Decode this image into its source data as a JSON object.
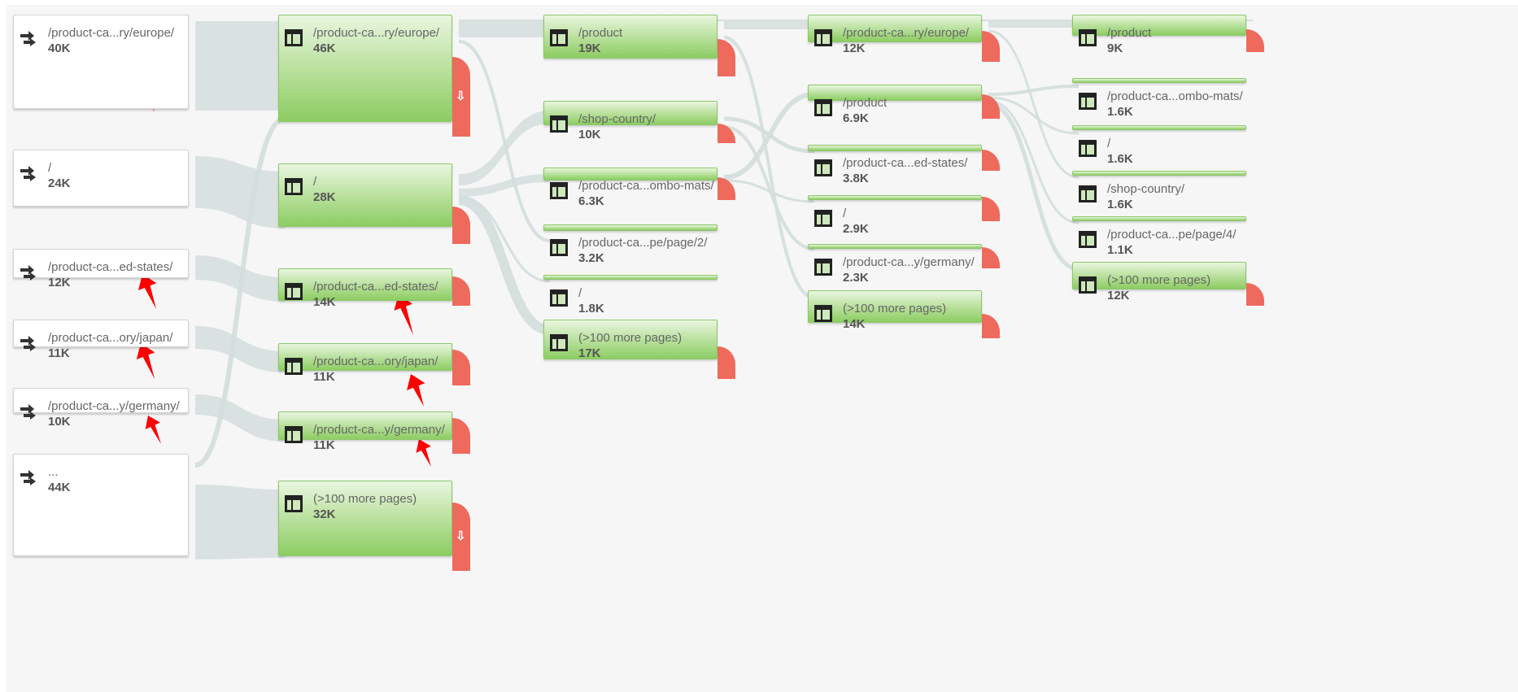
{
  "step0": [
    {
      "label": "/product-ca...ry/europe/",
      "value": "40K"
    },
    {
      "label": "/",
      "value": "24K"
    },
    {
      "label": "/product-ca...ed-states/",
      "value": "12K"
    },
    {
      "label": "/product-ca...ory/japan/",
      "value": "11K"
    },
    {
      "label": "/product-ca...y/germany/",
      "value": "10K"
    },
    {
      "label": "...",
      "value": "44K"
    }
  ],
  "step1": [
    {
      "label": "/product-ca...ry/europe/",
      "value": "46K"
    },
    {
      "label": "/",
      "value": "28K"
    },
    {
      "label": "/product-ca...ed-states/",
      "value": "14K"
    },
    {
      "label": "/product-ca...ory/japan/",
      "value": "11K"
    },
    {
      "label": "/product-ca...y/germany/",
      "value": "11K"
    },
    {
      "label": "(>100 more pages)",
      "value": "32K"
    }
  ],
  "step2": [
    {
      "label": "/product",
      "value": "19K"
    },
    {
      "label": "/shop-country/",
      "value": "10K"
    },
    {
      "label": "/product-ca...ombo-mats/",
      "value": "6.3K"
    },
    {
      "label": "/product-ca...pe/page/2/",
      "value": "3.2K"
    },
    {
      "label": "/",
      "value": "1.8K"
    },
    {
      "label": "(>100 more pages)",
      "value": "17K"
    }
  ],
  "step3": [
    {
      "label": "/product-ca...ry/europe/",
      "value": "12K"
    },
    {
      "label": "/product",
      "value": "6.9K"
    },
    {
      "label": "/product-ca...ed-states/",
      "value": "3.8K"
    },
    {
      "label": "/",
      "value": "2.9K"
    },
    {
      "label": "/product-ca...y/germany/",
      "value": "2.3K"
    },
    {
      "label": "(>100 more pages)",
      "value": "14K"
    }
  ],
  "step4": [
    {
      "label": "/product",
      "value": "9K"
    },
    {
      "label": "/product-ca...ombo-mats/",
      "value": "1.6K"
    },
    {
      "label": "/",
      "value": "1.6K"
    },
    {
      "label": "/shop-country/",
      "value": "1.6K"
    },
    {
      "label": "/product-ca...pe/page/4/",
      "value": "1.1K"
    },
    {
      "label": "(>100 more pages)",
      "value": "12K"
    }
  ],
  "drop_symbol": "⇩",
  "colors": {
    "node_green": "#8ccd62",
    "dropoff_red": "#ee6a5c",
    "flow_gray": "#d3dedd",
    "annotation_arrow": "#ff0000"
  },
  "icons": {
    "entry": "entrance-arrows-icon",
    "page": "page-layout-icon"
  }
}
